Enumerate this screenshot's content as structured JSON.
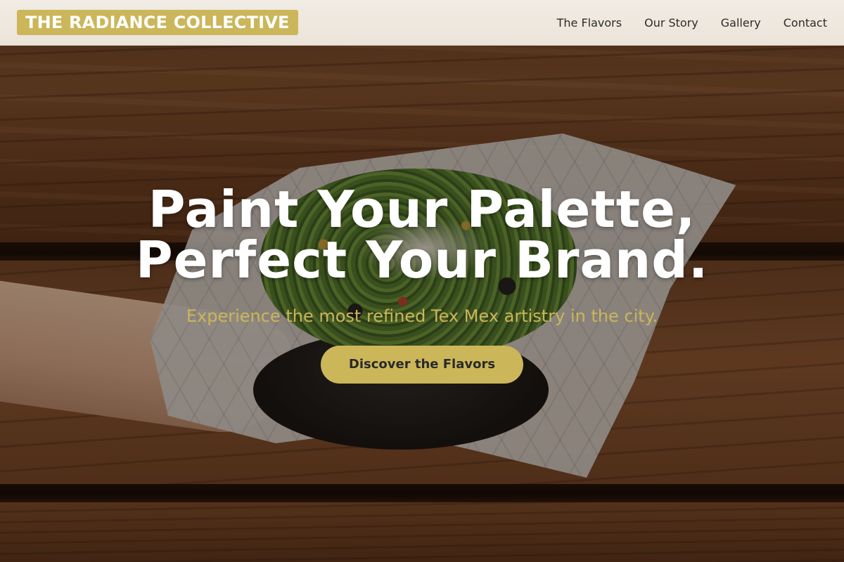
{
  "brand": {
    "logo_text": "THE RADIANCE COLLECTIVE"
  },
  "nav": {
    "items": [
      {
        "label": "The Flavors"
      },
      {
        "label": "Our Story"
      },
      {
        "label": "Gallery"
      },
      {
        "label": "Contact"
      }
    ]
  },
  "hero": {
    "headline_line1": "Paint Your Palette,",
    "headline_line2": "Perfect Your Brand.",
    "subtitle": "Experience the most refined Tex Mex artistry in the city.",
    "cta_label": "Discover the Flavors",
    "background_image": "burrito-bowl-on-wooden-table"
  },
  "colors": {
    "accent": "#cbb65a",
    "nav_bg": "#eee8de",
    "nav_text": "#2b2b2b",
    "headline": "#ffffff"
  }
}
